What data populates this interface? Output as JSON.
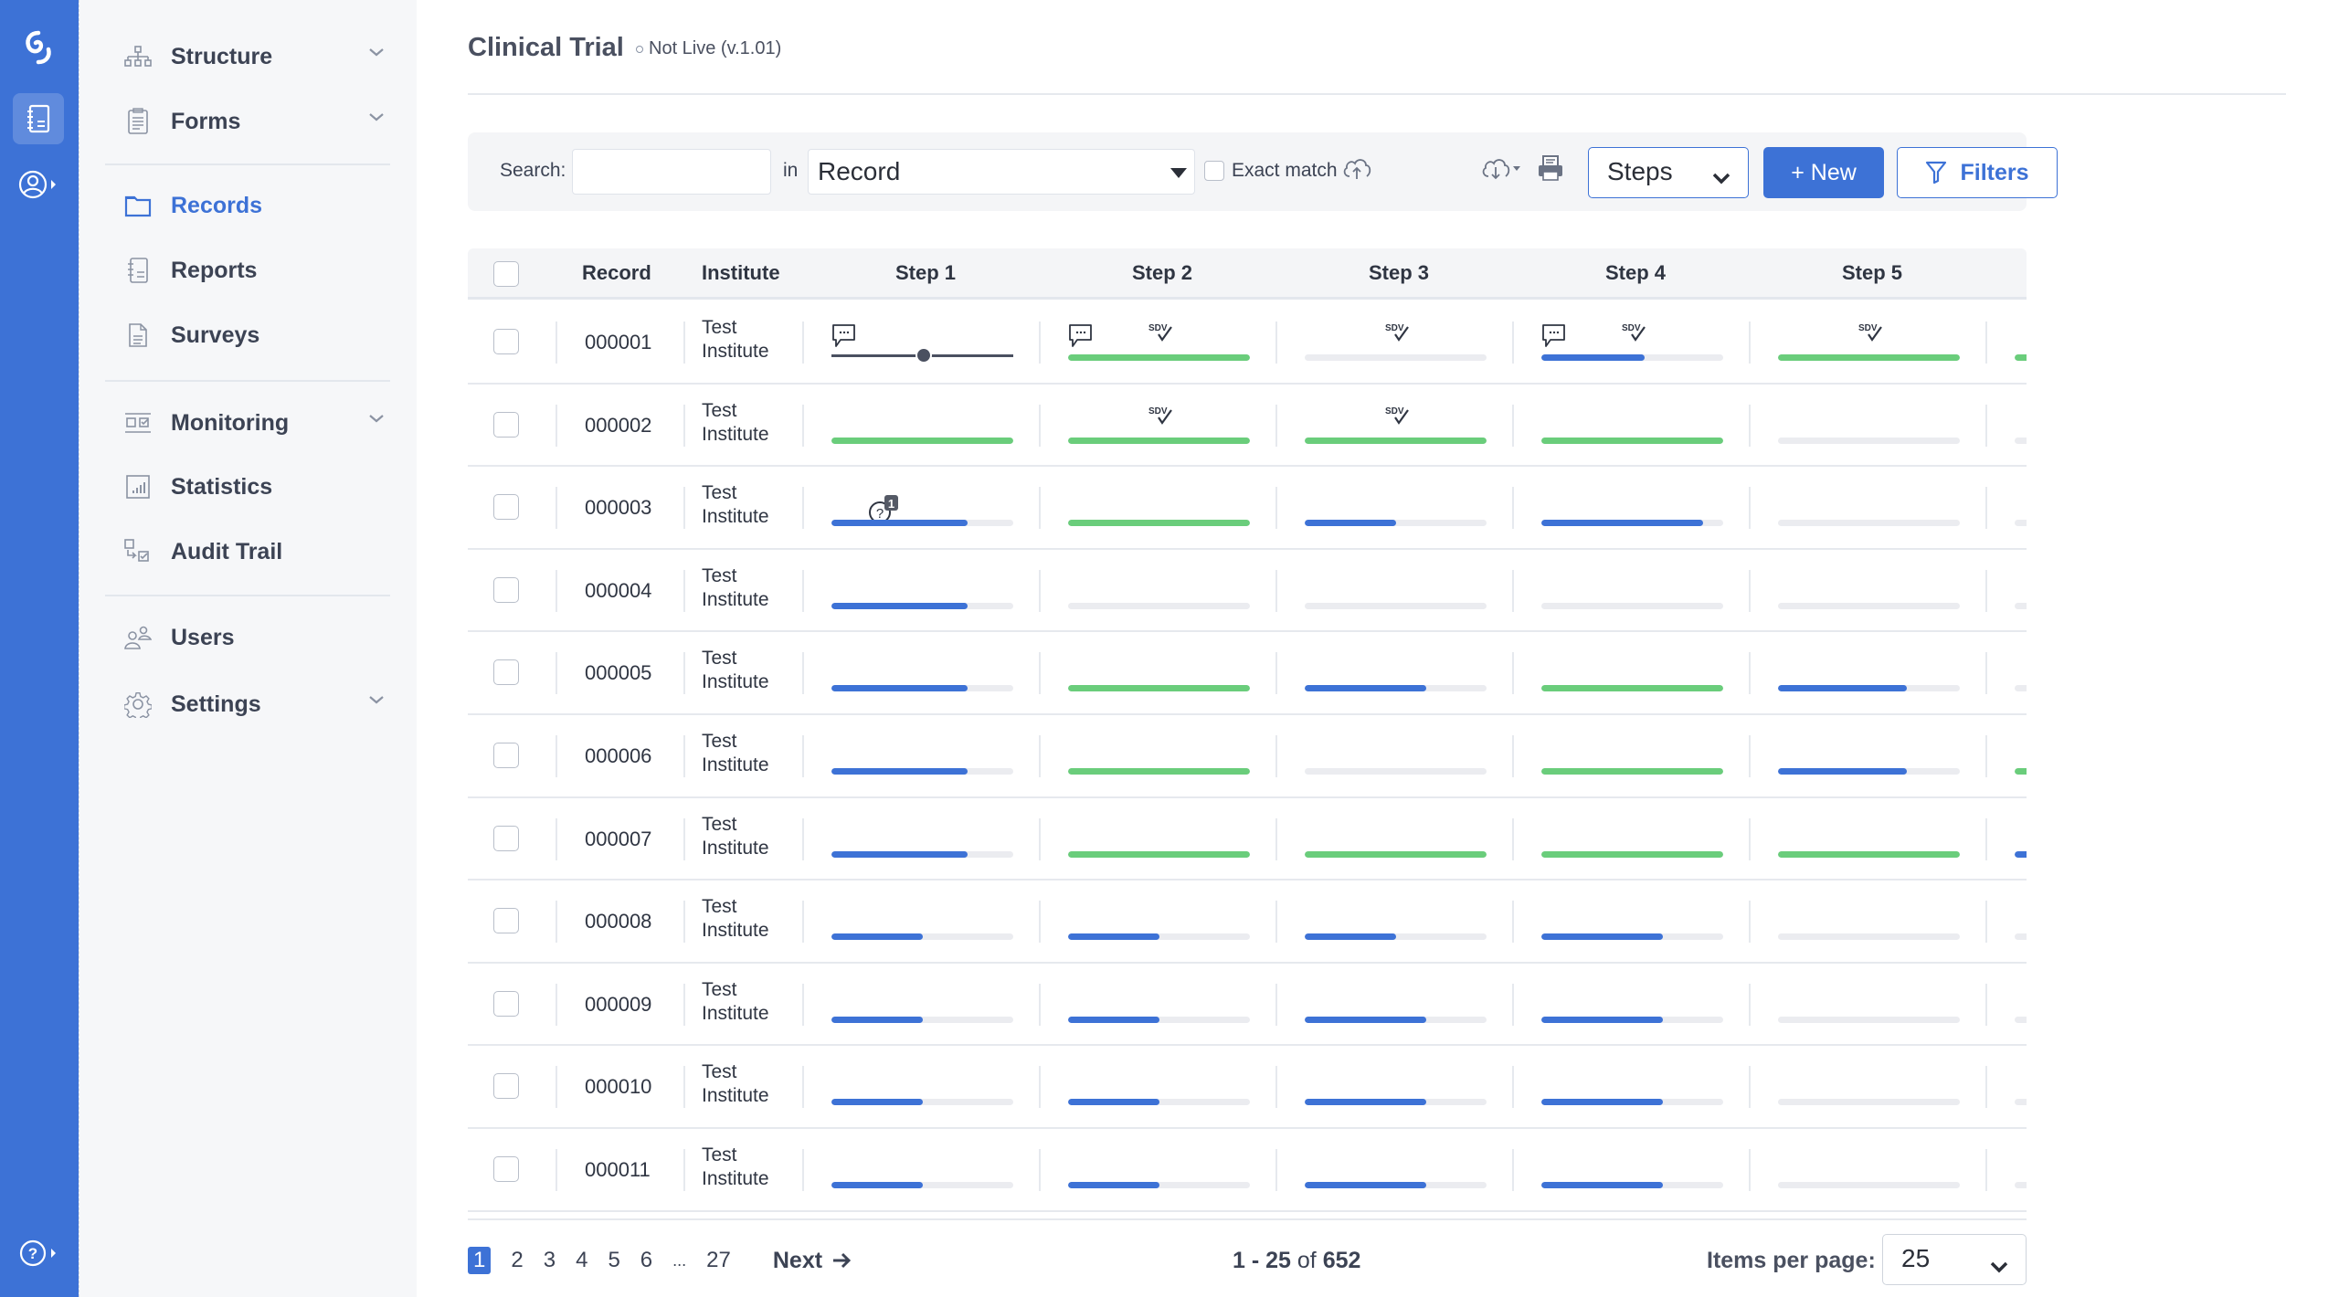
{
  "rail": {
    "items": [
      {
        "name": "app-logo-icon"
      },
      {
        "name": "records-book-icon",
        "active": true
      },
      {
        "name": "account-icon"
      }
    ],
    "help": "help-icon"
  },
  "nav": {
    "items": [
      {
        "label": "Structure",
        "icon": "hierarchy-icon",
        "expandable": true
      },
      {
        "label": "Forms",
        "icon": "clipboard-icon",
        "expandable": true
      },
      {
        "label": "Records",
        "icon": "folder-icon",
        "active": true
      },
      {
        "label": "Reports",
        "icon": "notebook-icon"
      },
      {
        "label": "Surveys",
        "icon": "document-icon"
      },
      {
        "label": "Monitoring",
        "icon": "monitoring-icon",
        "expandable": true
      },
      {
        "label": "Statistics",
        "icon": "bar-chart-icon"
      },
      {
        "label": "Audit Trail",
        "icon": "audit-trail-icon"
      },
      {
        "label": "Users",
        "icon": "users-icon"
      },
      {
        "label": "Settings",
        "icon": "gear-icon",
        "expandable": true
      }
    ]
  },
  "header": {
    "title": "Clinical Trial",
    "status": "Not Live (v.1.01)"
  },
  "toolbar": {
    "search_label": "Search:",
    "search_value": "",
    "search_placeholder": "",
    "in_label": "in",
    "field_select": "Record",
    "exact_match_label": "Exact match",
    "exact_match_checked": false,
    "view_select": "Steps",
    "new_label": "+ New",
    "filters_label": "Filters"
  },
  "table": {
    "columns": [
      "Record",
      "Institute",
      "Step 1",
      "Step 2",
      "Step 3",
      "Step 4",
      "Step 5"
    ],
    "rows": [
      {
        "record": "000001",
        "inst1": "Test",
        "inst2": "Institute",
        "steps": [
          {
            "type": "slider",
            "comment": true
          },
          {
            "pct": 100,
            "color": "green",
            "comment": true,
            "sdv": true
          },
          {
            "pct": 0,
            "sdv": true
          },
          {
            "pct": 57,
            "color": "blue",
            "comment": true,
            "sdv": true
          },
          {
            "pct": 100,
            "color": "green",
            "sdv": true
          },
          {
            "pct": 100,
            "color": "green"
          }
        ]
      },
      {
        "record": "000002",
        "inst1": "Test",
        "inst2": "Institute",
        "steps": [
          {
            "pct": 100,
            "color": "green"
          },
          {
            "pct": 100,
            "color": "green",
            "sdv": true
          },
          {
            "pct": 100,
            "color": "green",
            "sdv": true
          },
          {
            "pct": 100,
            "color": "green"
          },
          {
            "pct": 0
          },
          {
            "pct": 0
          }
        ]
      },
      {
        "record": "000003",
        "inst1": "Test",
        "inst2": "Institute",
        "steps": [
          {
            "pct": 75,
            "color": "blue",
            "query": "1"
          },
          {
            "pct": 100,
            "color": "green"
          },
          {
            "pct": 50,
            "color": "blue"
          },
          {
            "pct": 89,
            "color": "blue"
          },
          {
            "pct": 0
          },
          {
            "pct": 0
          }
        ]
      },
      {
        "record": "000004",
        "inst1": "Test",
        "inst2": "Institute",
        "steps": [
          {
            "pct": 75,
            "color": "blue"
          },
          {
            "pct": 0
          },
          {
            "pct": 0
          },
          {
            "pct": 0
          },
          {
            "pct": 0
          },
          {
            "pct": 0
          }
        ]
      },
      {
        "record": "000005",
        "inst1": "Test",
        "inst2": "Institute",
        "steps": [
          {
            "pct": 75,
            "color": "blue"
          },
          {
            "pct": 100,
            "color": "green"
          },
          {
            "pct": 67,
            "color": "blue"
          },
          {
            "pct": 100,
            "color": "green"
          },
          {
            "pct": 71,
            "color": "blue"
          },
          {
            "pct": 0
          }
        ]
      },
      {
        "record": "000006",
        "inst1": "Test",
        "inst2": "Institute",
        "steps": [
          {
            "pct": 75,
            "color": "blue"
          },
          {
            "pct": 100,
            "color": "green"
          },
          {
            "pct": 0
          },
          {
            "pct": 100,
            "color": "green"
          },
          {
            "pct": 71,
            "color": "blue"
          },
          {
            "pct": 100,
            "color": "green"
          }
        ]
      },
      {
        "record": "000007",
        "inst1": "Test",
        "inst2": "Institute",
        "steps": [
          {
            "pct": 75,
            "color": "blue"
          },
          {
            "pct": 100,
            "color": "green"
          },
          {
            "pct": 100,
            "color": "green"
          },
          {
            "pct": 100,
            "color": "green"
          },
          {
            "pct": 100,
            "color": "green"
          },
          {
            "pct": 50,
            "color": "blue"
          }
        ]
      },
      {
        "record": "000008",
        "inst1": "Test",
        "inst2": "Institute",
        "steps": [
          {
            "pct": 50,
            "color": "blue"
          },
          {
            "pct": 50,
            "color": "blue"
          },
          {
            "pct": 50,
            "color": "blue"
          },
          {
            "pct": 67,
            "color": "blue"
          },
          {
            "pct": 0
          },
          {
            "pct": 0
          }
        ]
      },
      {
        "record": "000009",
        "inst1": "Test",
        "inst2": "Institute",
        "steps": [
          {
            "pct": 50,
            "color": "blue"
          },
          {
            "pct": 50,
            "color": "blue"
          },
          {
            "pct": 67,
            "color": "blue"
          },
          {
            "pct": 67,
            "color": "blue"
          },
          {
            "pct": 0
          },
          {
            "pct": 0
          }
        ]
      },
      {
        "record": "000010",
        "inst1": "Test",
        "inst2": "Institute",
        "steps": [
          {
            "pct": 50,
            "color": "blue"
          },
          {
            "pct": 50,
            "color": "blue"
          },
          {
            "pct": 67,
            "color": "blue"
          },
          {
            "pct": 67,
            "color": "blue"
          },
          {
            "pct": 0
          },
          {
            "pct": 0
          }
        ]
      },
      {
        "record": "000011",
        "inst1": "Test",
        "inst2": "Institute",
        "steps": [
          {
            "pct": 50,
            "color": "blue"
          },
          {
            "pct": 50,
            "color": "blue"
          },
          {
            "pct": 67,
            "color": "blue"
          },
          {
            "pct": 67,
            "color": "blue"
          },
          {
            "pct": 0
          },
          {
            "pct": 0
          }
        ]
      }
    ]
  },
  "pagination": {
    "pages": [
      "1",
      "2",
      "3",
      "4",
      "5",
      "6",
      "...",
      "27"
    ],
    "current": "1",
    "next_label": "Next",
    "range_prefix": "1 - 25",
    "range_of": "of",
    "range_total": "652",
    "items_per_page_label": "Items per page:",
    "items_per_page": "25"
  },
  "colors": {
    "brand": "#3d72d6",
    "progress_blue": "#3d72d6",
    "progress_green": "#6acd7b",
    "track": "#ebecf0"
  }
}
